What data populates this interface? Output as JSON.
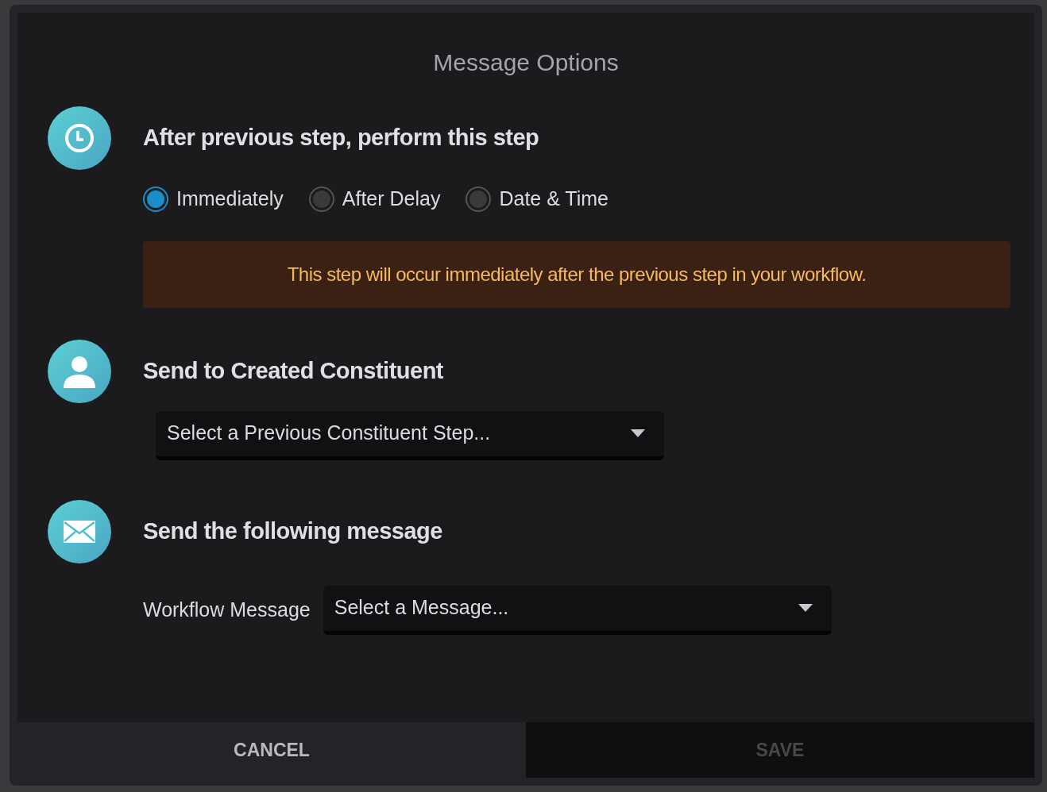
{
  "dialog": {
    "title": "Message Options"
  },
  "sections": [
    {
      "kind": "timing",
      "heading": "After previous step, perform this step",
      "options": [
        {
          "label": "Immediately",
          "selected": true
        },
        {
          "label": "After Delay",
          "selected": false
        },
        {
          "label": "Date & Time",
          "selected": false
        }
      ],
      "notice": "This step will occur immediately after the previous step in your workflow."
    },
    {
      "kind": "recipient",
      "heading": "Send to Created Constituent",
      "select": {
        "placeholder": "Select a Previous Constituent Step..."
      }
    },
    {
      "kind": "message",
      "heading": "Send the following message",
      "field_label": "Workflow Message",
      "select": {
        "placeholder": "Select a Message..."
      }
    }
  ],
  "buttons": [
    {
      "label": "CANCEL",
      "disabled": false
    },
    {
      "label": "SAVE",
      "disabled": true
    }
  ]
}
